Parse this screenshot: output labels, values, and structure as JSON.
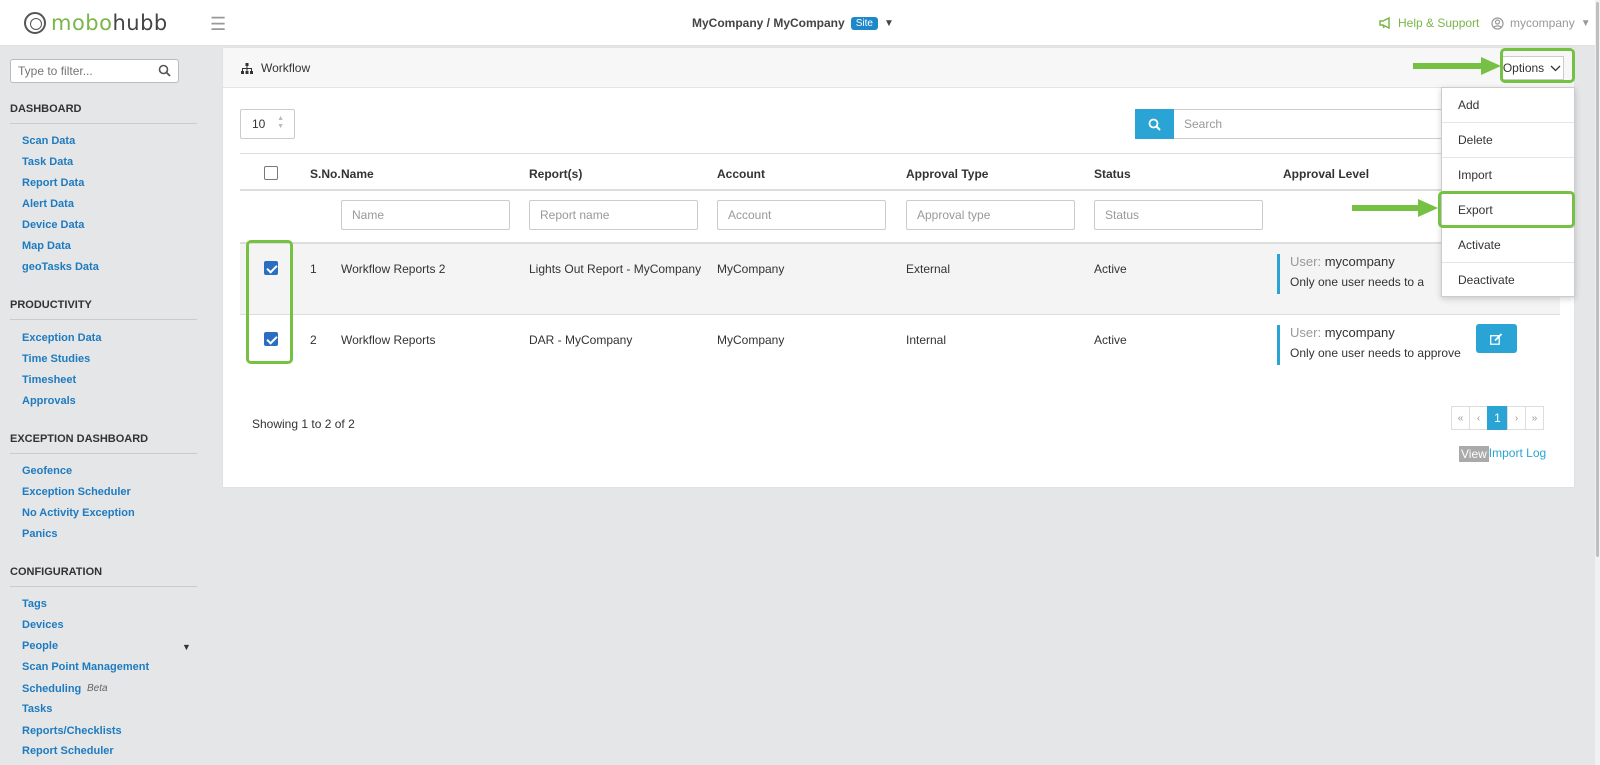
{
  "app": {
    "logo_part1": "mobo",
    "logo_part2": "hubb"
  },
  "header": {
    "company": "MyCompany / MyCompany",
    "site_badge": "Site",
    "help": "Help & Support",
    "user": "mycompany"
  },
  "sidebar": {
    "filter_placeholder": "Type to filter...",
    "sections": [
      {
        "title": "DASHBOARD",
        "items": [
          "Scan Data",
          "Task Data",
          "Report Data",
          "Alert Data",
          "Device Data",
          "Map Data",
          "geoTasks Data"
        ]
      },
      {
        "title": "PRODUCTIVITY",
        "items": [
          "Exception Data",
          "Time Studies",
          "Timesheet",
          "Approvals"
        ]
      },
      {
        "title": "EXCEPTION DASHBOARD",
        "items": [
          "Geofence",
          "Exception Scheduler",
          "No Activity Exception",
          "Panics"
        ]
      },
      {
        "title": "CONFIGURATION",
        "items": [
          "Tags",
          "Devices",
          "People",
          "Scan Point Management",
          "Scheduling",
          "Tasks",
          "Reports/Checklists",
          "Report Scheduler"
        ]
      }
    ],
    "scheduling_badge": "Beta"
  },
  "panel": {
    "title": "Workflow",
    "options_label": "Options",
    "page_length": "10",
    "search_placeholder": "Search",
    "columns": [
      "S.No.",
      "Name",
      "Report(s)",
      "Account",
      "Approval Type",
      "Status",
      "Approval Level"
    ],
    "filters": {
      "name": "Name",
      "report": "Report name",
      "account": "Account",
      "approval_type": "Approval type",
      "status": "Status"
    },
    "rows": [
      {
        "sno": "1",
        "name": "Workflow Reports 2",
        "reports": "Lights Out Report - MyCompany",
        "account": "MyCompany",
        "approval_type": "External",
        "status": "Active",
        "checked": true,
        "level_user_label": "User:",
        "level_user": "mycompany",
        "level_note": "Only one user needs to a"
      },
      {
        "sno": "2",
        "name": "Workflow Reports",
        "reports": "DAR - MyCompany",
        "account": "MyCompany",
        "approval_type": "Internal",
        "status": "Active",
        "checked": true,
        "level_user_label": "User:",
        "level_user": "mycompany",
        "level_note": "Only one user needs to approve"
      }
    ],
    "showing": "Showing 1 to 2 of 2",
    "pager": [
      "«",
      "‹",
      "1",
      "›",
      "»"
    ],
    "view_label": "View",
    "import_log_label": "Import Log"
  },
  "options_menu": [
    "Add",
    "Delete",
    "Import",
    "Export",
    "Activate",
    "Deactivate"
  ],
  "colors": {
    "accent": "#2aa4d5",
    "brand_green": "#7ab648",
    "highlight_green": "#76c043",
    "nav_link": "#1e7bbf"
  }
}
